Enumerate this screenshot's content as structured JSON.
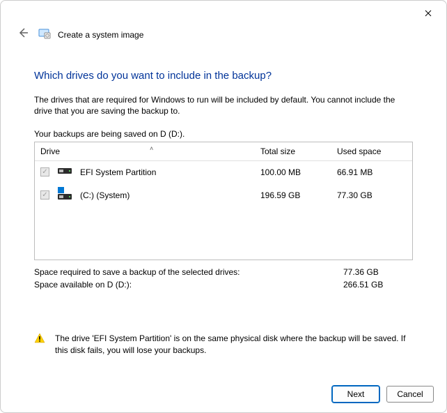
{
  "window": {
    "title": "Create a system image"
  },
  "page": {
    "heading": "Which drives do you want to include in the backup?",
    "description": "The drives that are required for Windows to run will be included by default. You cannot include the drive that you are saving the backup to.",
    "saved_msg": "Your backups are being saved on D (D:)."
  },
  "table": {
    "headers": {
      "drive": "Drive",
      "total": "Total size",
      "used": "Used space"
    },
    "rows": [
      {
        "name": "EFI System Partition",
        "total": "100.00 MB",
        "used": "66.91 MB",
        "checked_disabled": true,
        "icon": "efi"
      },
      {
        "name": "(C:) (System)",
        "total": "196.59 GB",
        "used": "77.30 GB",
        "checked_disabled": true,
        "icon": "system"
      }
    ]
  },
  "summary": {
    "required_label": "Space required to save a backup of the selected drives:",
    "required_value": "77.36 GB",
    "available_label": "Space available on D (D:):",
    "available_value": "266.51 GB"
  },
  "warning": {
    "text": "The drive 'EFI System Partition' is on the same physical disk where the backup will be saved. If this disk fails, you will lose your backups."
  },
  "buttons": {
    "next": "Next",
    "cancel": "Cancel"
  }
}
